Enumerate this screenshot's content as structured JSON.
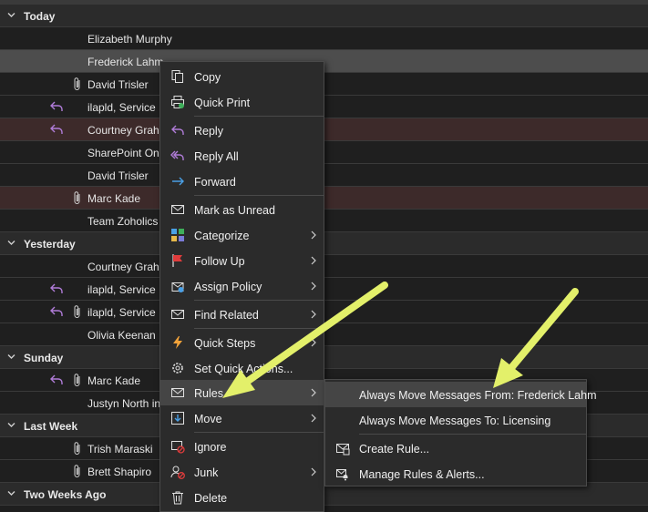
{
  "groups": [
    {
      "label": "Today"
    },
    {
      "label": "Yesterday"
    },
    {
      "label": "Sunday"
    },
    {
      "label": "Last Week"
    },
    {
      "label": "Two Weeks Ago"
    }
  ],
  "messages": [
    {
      "from": "Elizabeth Murphy"
    },
    {
      "from": "Frederick Lahm"
    },
    {
      "from": "David Trisler"
    },
    {
      "from": "ilapld, Service"
    },
    {
      "from": "Courtney Graha"
    },
    {
      "from": "SharePoint Onl"
    },
    {
      "from": "David Trisler"
    },
    {
      "from": "Marc Kade"
    },
    {
      "from": "Team Zoholics"
    },
    {
      "from": "Courtney Graha"
    },
    {
      "from": "ilapld, Service"
    },
    {
      "from": "ilapld, Service"
    },
    {
      "from": "Olivia Keenan"
    },
    {
      "from": "Marc Kade"
    },
    {
      "from": "Justyn North in"
    },
    {
      "from": "Trish Maraski"
    },
    {
      "from": "Brett Shapiro"
    }
  ],
  "context_menu": {
    "items": [
      {
        "label": "Copy",
        "icon": "copy-icon"
      },
      {
        "label": "Quick Print",
        "icon": "print-icon"
      },
      {
        "label": "Reply",
        "icon": "reply-icon"
      },
      {
        "label": "Reply All",
        "icon": "reply-all-icon"
      },
      {
        "label": "Forward",
        "icon": "forward-icon"
      },
      {
        "label": "Mark as Unread",
        "icon": "envelope-icon"
      },
      {
        "label": "Categorize",
        "icon": "categorize-icon"
      },
      {
        "label": "Follow Up",
        "icon": "flag-icon"
      },
      {
        "label": "Assign Policy",
        "icon": "policy-icon"
      },
      {
        "label": "Find Related",
        "icon": "find-related-icon"
      },
      {
        "label": "Quick Steps",
        "icon": "lightning-icon"
      },
      {
        "label": "Set Quick Actions...",
        "icon": "gear-icon"
      },
      {
        "label": "Rules",
        "icon": "rules-icon"
      },
      {
        "label": "Move",
        "icon": "move-icon"
      },
      {
        "label": "Ignore",
        "icon": "ignore-icon"
      },
      {
        "label": "Junk",
        "icon": "junk-icon"
      },
      {
        "label": "Delete",
        "icon": "trash-icon"
      }
    ]
  },
  "rules_submenu": {
    "items": [
      {
        "label": "Always Move Messages From: Frederick Lahm"
      },
      {
        "label": "Always Move Messages To: Licensing"
      },
      {
        "label": "Create Rule...",
        "icon": "create-rule-icon"
      },
      {
        "label": "Manage Rules & Alerts...",
        "icon": "manage-rules-icon"
      }
    ]
  },
  "colors": {
    "background": "#1f1f1f",
    "group_header": "#2b2b2b",
    "selected_row": "#4d4d4d",
    "flagged_row": "#3d2a2a",
    "menu_bg": "#2b2b2b",
    "menu_hover": "#454545",
    "reply_icon": "#b07cd8",
    "annotation_arrow": "#e3f06a"
  }
}
